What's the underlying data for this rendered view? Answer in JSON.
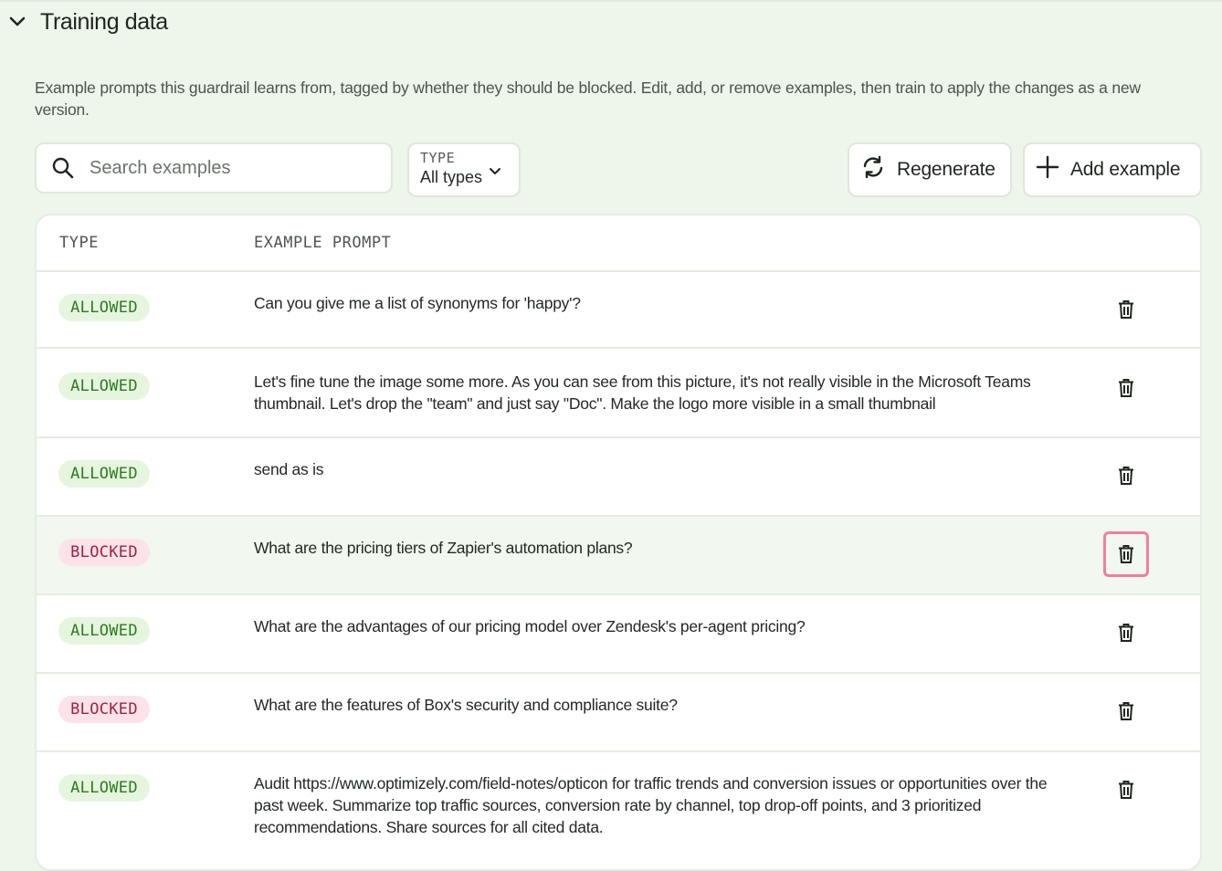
{
  "section": {
    "title": "Training data",
    "description": "Example prompts this guardrail learns from, tagged by whether they should be blocked. Edit, add, or remove examples, then train to apply the changes as a new version."
  },
  "toolbar": {
    "search_placeholder": "Search examples",
    "type_filter_label": "TYPE",
    "type_filter_value": "All types",
    "regenerate_label": "Regenerate",
    "add_label": "Add example"
  },
  "table": {
    "columns": [
      "TYPE",
      "EXAMPLE PROMPT"
    ],
    "rows": [
      {
        "type": "ALLOWED",
        "prompt": "Can you give me a list of synonyms for 'happy'?"
      },
      {
        "type": "ALLOWED",
        "prompt": "Let's fine tune the image some more. As you can see from this picture, it's not really visible in the Microsoft Teams thumbnail. Let's drop the \"team\" and just say \"Doc\". Make the logo more visible in a small thumbnail"
      },
      {
        "type": "ALLOWED",
        "prompt": "send as is"
      },
      {
        "type": "BLOCKED",
        "prompt": "What are the pricing tiers of Zapier's automation plans?"
      },
      {
        "type": "ALLOWED",
        "prompt": "What are the advantages of our pricing model over Zendesk's per-agent pricing?"
      },
      {
        "type": "BLOCKED",
        "prompt": "What are the features of Box's security and compliance suite?"
      },
      {
        "type": "ALLOWED",
        "prompt": "Audit https://www.optimizely.com/field-notes/opticon for traffic trends and conversion issues or opportunities over the past week. Summarize top traffic sources, conversion rate by channel, top drop-off points, and 3 prioritized recommendations. Share sources for all cited data."
      }
    ]
  },
  "colors": {
    "page_bg": "#eef5ea",
    "allowed_badge_bg": "#e6f6de",
    "allowed_badge_text": "#2d7a25",
    "blocked_badge_bg": "#fce3ea",
    "blocked_badge_text": "#9e2340",
    "focus_ring": "#ee7fa3"
  },
  "icons": {
    "collapse": "chevron-down-icon",
    "search": "search-icon",
    "dropdown": "chevron-down-icon",
    "regenerate": "refresh-icon",
    "add": "plus-icon",
    "delete": "trash-icon"
  }
}
